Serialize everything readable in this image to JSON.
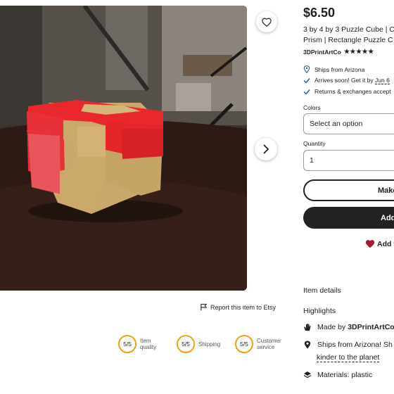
{
  "product": {
    "price": "$6.50",
    "title_line1": "3 by 4 by 3 Puzzle Cube | C",
    "title_line2": "Prism | Rectangle Puzzle C",
    "shop_name": "3DPrintArtCo",
    "stars": "★★★★★",
    "rating_value": 5
  },
  "shipping": {
    "ships_from": "Ships from Arizona",
    "arrives_prefix": "Arrives soon! Get it by",
    "arrives_date": "Jun 6",
    "returns": "Returns & exchanges accept"
  },
  "options": {
    "colors_label": "Colors",
    "colors_placeholder": "Select an option",
    "quantity_label": "Quantity",
    "quantity_value": "1"
  },
  "buttons": {
    "make_offer": "Make",
    "add_to_cart": "Add",
    "add_to_favorites": "Add t"
  },
  "report": {
    "label": "Report this item to Etsy"
  },
  "ratings": [
    {
      "score": "5/5",
      "label_line1": "Item",
      "label_line2": "quality"
    },
    {
      "score": "5/5",
      "label_line1": "Shipping",
      "label_line2": ""
    },
    {
      "score": "5/5",
      "label_line1": "Customer",
      "label_line2": "service"
    }
  ],
  "item_details": {
    "heading": "Item details",
    "highlights_heading": "Highlights",
    "made_by_prefix": "Made by",
    "made_by_shop": "3DPrintArtCo",
    "ships_from_line": "Ships from Arizona! Sh",
    "ships_from_link": "kinder to the planet",
    "materials": "Materials: plastic"
  },
  "colors": {
    "accent_dark": "#222222",
    "rating_ring": "#f1a10d",
    "favorite_heart": "#a61a2e",
    "check": "#1f5e9b"
  }
}
